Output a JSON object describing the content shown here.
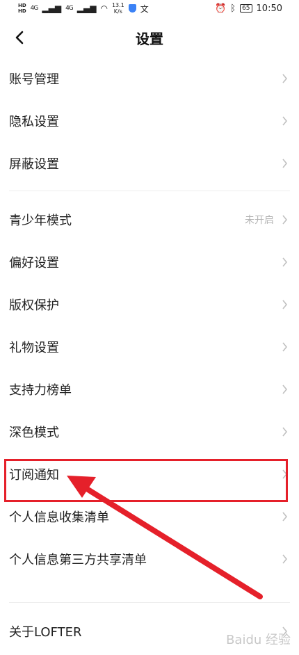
{
  "status_bar": {
    "network_speed": "13.1",
    "network_unit": "K/s",
    "signal1": "4G",
    "signal2": "4G",
    "battery": "65",
    "time": "10:50",
    "ime_char": "文"
  },
  "header": {
    "title": "设置"
  },
  "groups": [
    {
      "items": [
        {
          "label": "账号管理"
        },
        {
          "label": "隐私设置"
        },
        {
          "label": "屏蔽设置"
        }
      ]
    },
    {
      "items": [
        {
          "label": "青少年模式",
          "value": "未开启"
        },
        {
          "label": "偏好设置"
        },
        {
          "label": "版权保护"
        },
        {
          "label": "礼物设置"
        },
        {
          "label": "支持力榜单"
        },
        {
          "label": "深色模式"
        },
        {
          "label": "订阅通知"
        },
        {
          "label": "个人信息收集清单"
        },
        {
          "label": "个人信息第三方共享清单"
        }
      ]
    },
    {
      "items": [
        {
          "label": "关于LOFTER"
        }
      ]
    }
  ],
  "watermark": "Baidu 经验",
  "colors": {
    "annotation": "#e5202a",
    "chevron": "#c0c0c0",
    "value_text": "#b4b4b4"
  }
}
